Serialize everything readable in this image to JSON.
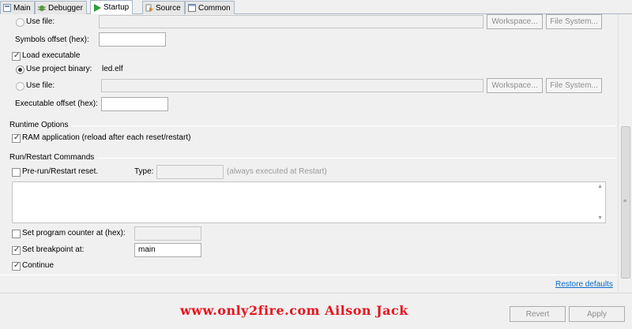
{
  "tabs": [
    {
      "label": "Main",
      "icon": "main-tab-icon"
    },
    {
      "label": "Debugger",
      "icon": "debugger-bug-icon"
    },
    {
      "label": "Startup",
      "icon": "startup-play-icon",
      "active": true
    },
    {
      "label": "Source",
      "icon": "source-icon"
    },
    {
      "label": "Common",
      "icon": "common-icon"
    }
  ],
  "load_symbols": {
    "use_file_label": "Use file:",
    "workspace_btn": "Workspace...",
    "filesystem_btn": "File System...",
    "symbols_offset_label": "Symbols offset (hex):",
    "symbols_offset_value": ""
  },
  "load_executable": {
    "label": "Load executable",
    "checked": true,
    "use_project_binary_label": "Use project binary:",
    "project_binary_value": "led.elf",
    "use_file_label": "Use file:",
    "workspace_btn": "Workspace...",
    "filesystem_btn": "File System...",
    "exec_offset_label": "Executable offset (hex):",
    "exec_offset_value": ""
  },
  "runtime": {
    "title": "Runtime Options",
    "ram_app_label": "RAM application (reload after each reset/restart)",
    "ram_app_checked": true
  },
  "run_restart": {
    "title": "Run/Restart Commands",
    "prerun_label": "Pre-run/Restart reset.",
    "prerun_checked": false,
    "type_label": "Type:",
    "type_value": "",
    "type_hint": "(always executed at Restart)",
    "set_pc_label": "Set program counter at (hex):",
    "set_pc_checked": false,
    "set_pc_value": "",
    "set_bp_label": "Set breakpoint at:",
    "set_bp_checked": true,
    "set_bp_value": "main",
    "continue_label": "Continue",
    "continue_checked": true
  },
  "restore_defaults": "Restore defaults",
  "footer": {
    "revert": "Revert",
    "apply": "Apply"
  },
  "watermark": "www.only2fire.com Ailson Jack",
  "colors": {
    "link": "#0b6bc8",
    "watermark": "#e8141d"
  }
}
